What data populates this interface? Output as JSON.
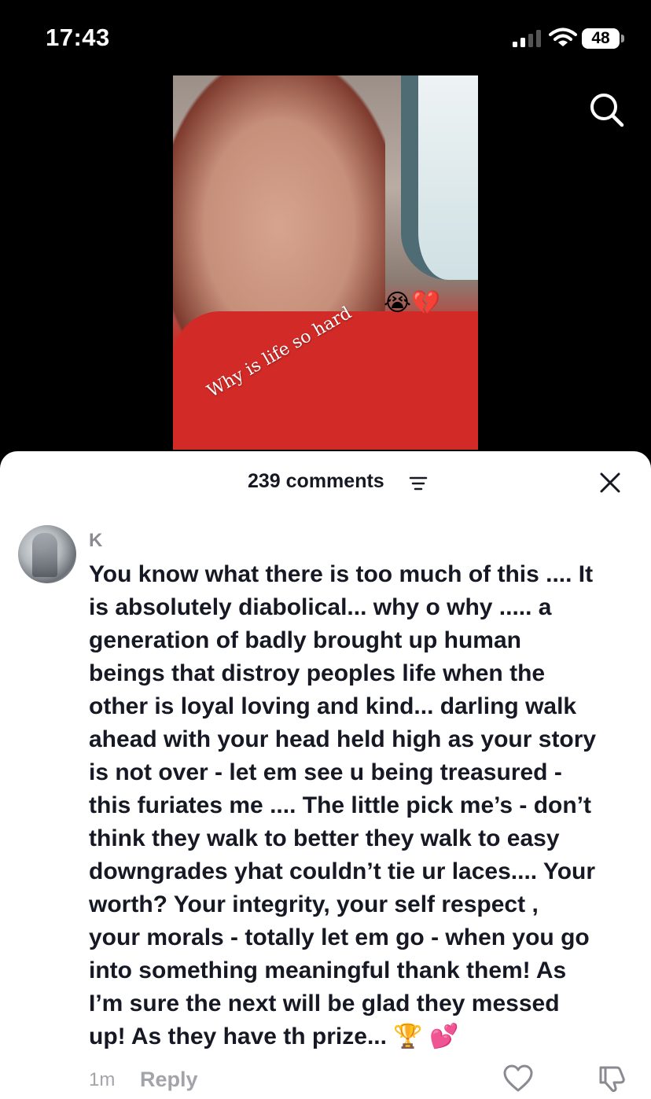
{
  "status_bar": {
    "time": "17:43",
    "battery": "48"
  },
  "video": {
    "caption": "Why is life so hard",
    "emoji": "😭💔"
  },
  "comments_sheet": {
    "count_label": "239 comments",
    "comment": {
      "username": "K",
      "text": "You know what there is too much of this .... It\nis absolutely diabolical... why o why ..... a\ngeneration of badly brought up human\nbeings that distroy peoples life when the\nother is loyal loving and kind... darling walk\nahead with your head held high as your story\nis not over - let em see u being treasured -\nthis furiates me .... The little pick me’s - don’t\nthink they walk to better they walk to easy\ndowngrades yhat couldn’t tie ur laces.... Your\nworth? Your integrity, your self respect ,\nyour morals - totally let em go - when you go\ninto something meaningful thank them! As\nI’m sure the next will be glad they messed\nup! As they have th prize...  🏆  💕",
      "time": "1m",
      "reply_label": "Reply"
    }
  },
  "colors": {
    "background": "#000000",
    "sheet": "#ffffff",
    "primary_text": "#161823",
    "secondary_text": "#a3a4aa"
  },
  "icons": [
    "signal-icon",
    "wifi-icon",
    "battery-icon",
    "search-icon",
    "filter-icon",
    "close-icon",
    "heart-icon",
    "dislike-icon"
  ]
}
